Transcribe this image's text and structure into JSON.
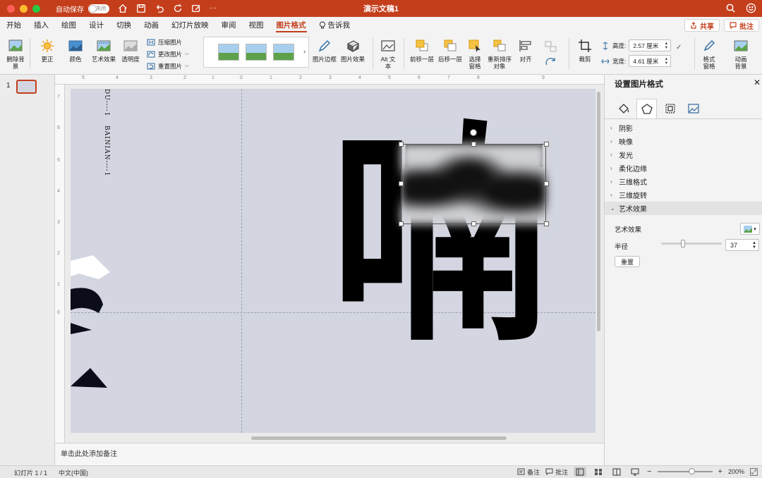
{
  "window": {
    "title": "演示文稿1",
    "autosave_label": "自动保存",
    "autosave_state": "关闭"
  },
  "menu": {
    "tabs": [
      "开始",
      "插入",
      "绘图",
      "设计",
      "切换",
      "动画",
      "幻灯片放映",
      "审阅",
      "视图",
      "图片格式"
    ],
    "active_tab": "图片格式",
    "tell_me": "告诉我",
    "share": "共享",
    "comments": "批注"
  },
  "ribbon": {
    "remove_bg": "删除背景",
    "corrections": "更正",
    "color": "颜色",
    "artistic_effects": "艺术效果",
    "transparency": "透明度",
    "compress": "压缩图片",
    "change_picture": "更改图片",
    "reset_picture": "重置图片",
    "picture_border": "图片边框",
    "picture_effects": "图片效果",
    "alt_text": "Alt 文本",
    "bring_forward": "前移一层",
    "send_backward": "后移一层",
    "selection_pane": "选择窗格",
    "reorder_objects": "重新排序对象",
    "align": "对齐",
    "crop": "裁剪",
    "height_label": "高度:",
    "height_value": "2.57 厘米",
    "width_label": "宽度:",
    "width_value": "4.61 厘米",
    "format_pane": "格式窗格",
    "animate_bg": "动画背景"
  },
  "ruler": {
    "top_ticks": [
      "5",
      "4",
      "3",
      "2",
      "1",
      "0",
      "1",
      "2",
      "3",
      "4",
      "5",
      "6",
      "7",
      "8",
      "9"
    ],
    "left_ticks": [
      "7",
      "6",
      "5",
      "4",
      "3",
      "2",
      "1",
      "0"
    ]
  },
  "thumbnails": {
    "slide_number": "1"
  },
  "slide": {
    "vertical_text_1": "DU----1",
    "vertical_text_2": "BAINIAN----1",
    "big_char": "喃"
  },
  "notes": {
    "placeholder": "单击此处添加备注"
  },
  "format_panel": {
    "title": "设置图片格式",
    "sections": [
      "阴影",
      "映像",
      "发光",
      "柔化边缘",
      "三维格式",
      "三维旋转",
      "艺术效果"
    ],
    "open_section": "艺术效果",
    "effect_label": "艺术效果",
    "radius_label": "半径",
    "radius_value": "37",
    "reset": "重置"
  },
  "status": {
    "slide_info": "幻灯片 1 / 1",
    "language": "中文(中国)",
    "notes": "备注",
    "comments": "批注",
    "zoom": "200%"
  },
  "colors": {
    "accent": "#c43e1c",
    "slide_bg": "#d3d6e0"
  }
}
